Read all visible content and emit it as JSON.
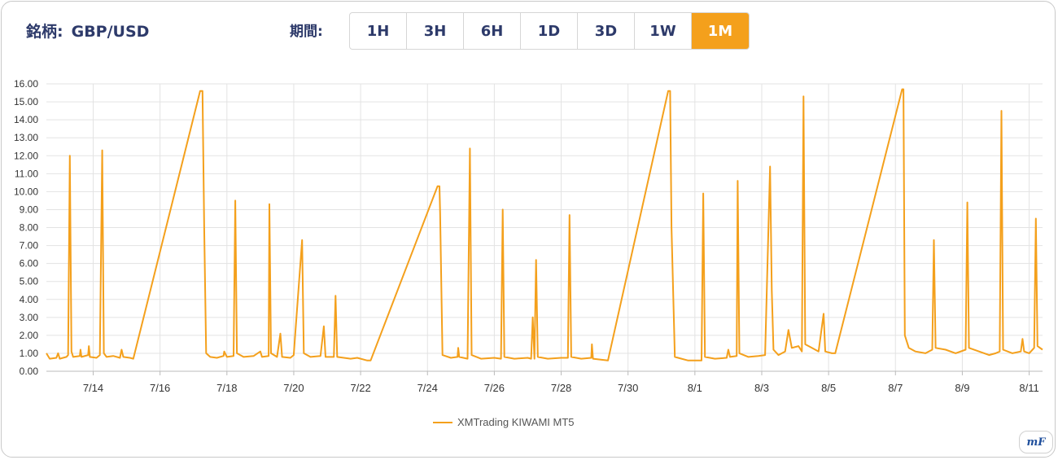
{
  "header": {
    "symbol_caption": "銘柄:",
    "symbol_value": "GBP/USD",
    "period_caption": "期間:",
    "periods": [
      "1H",
      "3H",
      "6H",
      "1D",
      "3D",
      "1W",
      "1M"
    ],
    "active_period": "1M"
  },
  "logo": {
    "text": "mF"
  },
  "colors": {
    "accent": "#f4a01c",
    "grid": "#e3e3e3",
    "axis_text": "#333333"
  },
  "chart_data": {
    "type": "line",
    "ylim": [
      0,
      16
    ],
    "yticks": [
      "0.00",
      "1.00",
      "2.00",
      "3.00",
      "4.00",
      "5.00",
      "6.00",
      "7.00",
      "8.00",
      "9.00",
      "10.00",
      "11.00",
      "12.00",
      "13.00",
      "14.00",
      "15.00",
      "16.00"
    ],
    "xlim": [
      12.6,
      42.4
    ],
    "xtick_positions": [
      14,
      16,
      18,
      20,
      22,
      24,
      26,
      28,
      30,
      32,
      34,
      36,
      38,
      40,
      42
    ],
    "xtick_labels": [
      "7/14",
      "7/16",
      "7/18",
      "7/20",
      "7/22",
      "7/24",
      "7/26",
      "7/28",
      "7/30",
      "8/1",
      "8/3",
      "8/5",
      "8/7",
      "8/9",
      "8/11"
    ],
    "legend": "bottom",
    "series": [
      {
        "name": "XMTrading KIWAMI MT5",
        "color": "#f4a01c",
        "points": [
          [
            12.6,
            1.0
          ],
          [
            12.7,
            0.7
          ],
          [
            12.9,
            0.75
          ],
          [
            12.95,
            1.0
          ],
          [
            13.0,
            0.7
          ],
          [
            13.2,
            0.8
          ],
          [
            13.25,
            0.9
          ],
          [
            13.3,
            12.0
          ],
          [
            13.35,
            1.1
          ],
          [
            13.4,
            0.8
          ],
          [
            13.6,
            0.85
          ],
          [
            13.62,
            1.2
          ],
          [
            13.65,
            0.8
          ],
          [
            13.85,
            0.9
          ],
          [
            13.87,
            1.4
          ],
          [
            13.9,
            0.8
          ],
          [
            14.1,
            0.75
          ],
          [
            14.2,
            0.9
          ],
          [
            14.27,
            12.3
          ],
          [
            14.32,
            1.0
          ],
          [
            14.4,
            0.8
          ],
          [
            14.6,
            0.85
          ],
          [
            14.8,
            0.75
          ],
          [
            14.85,
            1.2
          ],
          [
            14.9,
            0.8
          ],
          [
            15.1,
            0.75
          ],
          [
            15.2,
            0.7
          ],
          [
            17.2,
            15.6
          ],
          [
            17.27,
            15.6
          ],
          [
            17.32,
            8.0
          ],
          [
            17.38,
            1.0
          ],
          [
            17.5,
            0.8
          ],
          [
            17.7,
            0.75
          ],
          [
            17.9,
            0.85
          ],
          [
            17.92,
            1.1
          ],
          [
            18.0,
            0.8
          ],
          [
            18.2,
            0.85
          ],
          [
            18.25,
            9.5
          ],
          [
            18.3,
            1.0
          ],
          [
            18.5,
            0.8
          ],
          [
            18.8,
            0.85
          ],
          [
            19.0,
            1.1
          ],
          [
            19.05,
            0.8
          ],
          [
            19.25,
            0.85
          ],
          [
            19.27,
            9.3
          ],
          [
            19.32,
            1.0
          ],
          [
            19.5,
            0.8
          ],
          [
            19.6,
            2.1
          ],
          [
            19.65,
            0.8
          ],
          [
            19.9,
            0.75
          ],
          [
            20.0,
            0.9
          ],
          [
            20.25,
            7.3
          ],
          [
            20.3,
            1.0
          ],
          [
            20.5,
            0.8
          ],
          [
            20.8,
            0.85
          ],
          [
            20.9,
            2.5
          ],
          [
            20.95,
            0.8
          ],
          [
            21.2,
            0.8
          ],
          [
            21.25,
            4.2
          ],
          [
            21.3,
            0.8
          ],
          [
            21.5,
            0.75
          ],
          [
            21.7,
            0.7
          ],
          [
            21.9,
            0.75
          ],
          [
            22.2,
            0.6
          ],
          [
            22.3,
            0.6
          ],
          [
            24.3,
            10.3
          ],
          [
            24.36,
            10.3
          ],
          [
            24.38,
            8.8
          ],
          [
            24.45,
            0.9
          ],
          [
            24.7,
            0.75
          ],
          [
            24.9,
            0.8
          ],
          [
            24.92,
            1.3
          ],
          [
            24.95,
            0.8
          ],
          [
            25.2,
            0.7
          ],
          [
            25.27,
            12.4
          ],
          [
            25.32,
            0.9
          ],
          [
            25.6,
            0.7
          ],
          [
            26.0,
            0.75
          ],
          [
            26.2,
            0.7
          ],
          [
            26.25,
            9.0
          ],
          [
            26.3,
            0.8
          ],
          [
            26.6,
            0.7
          ],
          [
            27.0,
            0.75
          ],
          [
            27.1,
            0.7
          ],
          [
            27.15,
            3.0
          ],
          [
            27.2,
            0.7
          ],
          [
            27.25,
            6.2
          ],
          [
            27.3,
            0.8
          ],
          [
            27.6,
            0.7
          ],
          [
            28.0,
            0.75
          ],
          [
            28.2,
            0.75
          ],
          [
            28.25,
            8.7
          ],
          [
            28.3,
            0.8
          ],
          [
            28.6,
            0.7
          ],
          [
            28.9,
            0.75
          ],
          [
            28.92,
            1.5
          ],
          [
            28.95,
            0.7
          ],
          [
            29.4,
            0.6
          ],
          [
            31.2,
            15.6
          ],
          [
            31.26,
            15.6
          ],
          [
            31.3,
            8.0
          ],
          [
            31.4,
            0.8
          ],
          [
            31.6,
            0.7
          ],
          [
            31.8,
            0.6
          ],
          [
            32.2,
            0.6
          ],
          [
            32.25,
            9.9
          ],
          [
            32.3,
            0.8
          ],
          [
            32.6,
            0.7
          ],
          [
            32.95,
            0.75
          ],
          [
            33.0,
            1.2
          ],
          [
            33.05,
            0.8
          ],
          [
            33.25,
            0.85
          ],
          [
            33.28,
            10.6
          ],
          [
            33.33,
            1.0
          ],
          [
            33.6,
            0.8
          ],
          [
            33.9,
            0.85
          ],
          [
            34.1,
            0.9
          ],
          [
            34.25,
            11.4
          ],
          [
            34.3,
            4.5
          ],
          [
            34.35,
            1.2
          ],
          [
            34.5,
            0.9
          ],
          [
            34.7,
            1.1
          ],
          [
            34.8,
            2.3
          ],
          [
            34.9,
            1.3
          ],
          [
            35.1,
            1.4
          ],
          [
            35.2,
            1.1
          ],
          [
            35.25,
            15.3
          ],
          [
            35.3,
            1.5
          ],
          [
            35.5,
            1.3
          ],
          [
            35.7,
            1.1
          ],
          [
            35.85,
            3.2
          ],
          [
            35.9,
            1.1
          ],
          [
            36.1,
            1.0
          ],
          [
            36.2,
            1.0
          ],
          [
            38.2,
            15.7
          ],
          [
            38.24,
            15.7
          ],
          [
            38.28,
            2.0
          ],
          [
            38.4,
            1.3
          ],
          [
            38.6,
            1.1
          ],
          [
            38.9,
            1.0
          ],
          [
            39.1,
            1.2
          ],
          [
            39.15,
            7.3
          ],
          [
            39.2,
            1.3
          ],
          [
            39.5,
            1.2
          ],
          [
            39.8,
            1.0
          ],
          [
            40.1,
            1.2
          ],
          [
            40.15,
            9.4
          ],
          [
            40.2,
            1.3
          ],
          [
            40.5,
            1.1
          ],
          [
            40.8,
            0.9
          ],
          [
            41.0,
            1.0
          ],
          [
            41.12,
            1.1
          ],
          [
            41.17,
            14.5
          ],
          [
            41.22,
            1.2
          ],
          [
            41.5,
            1.0
          ],
          [
            41.75,
            1.1
          ],
          [
            41.8,
            1.8
          ],
          [
            41.85,
            1.1
          ],
          [
            42.0,
            1.0
          ],
          [
            42.15,
            1.3
          ],
          [
            42.2,
            8.5
          ],
          [
            42.25,
            1.4
          ],
          [
            42.4,
            1.2
          ]
        ]
      }
    ]
  }
}
